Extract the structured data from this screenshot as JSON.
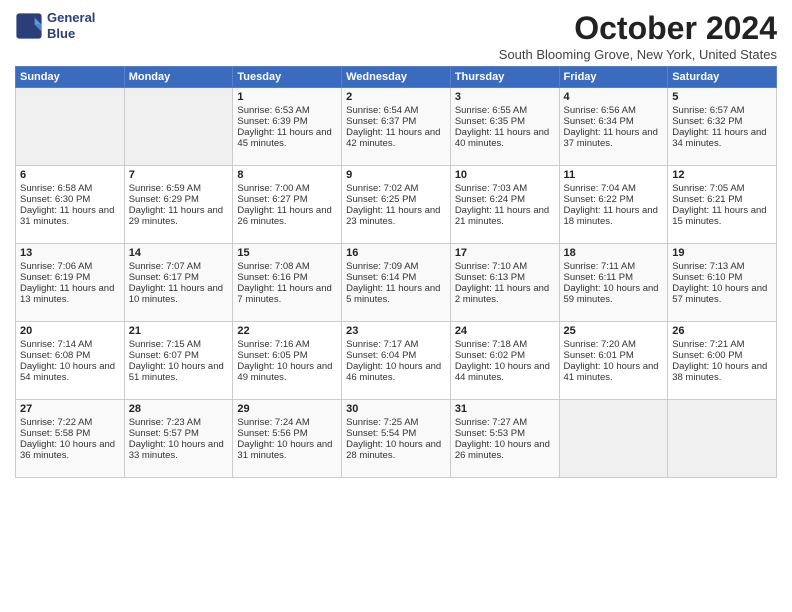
{
  "header": {
    "logo_line1": "General",
    "logo_line2": "Blue",
    "title": "October 2024",
    "location": "South Blooming Grove, New York, United States"
  },
  "days_of_week": [
    "Sunday",
    "Monday",
    "Tuesday",
    "Wednesday",
    "Thursday",
    "Friday",
    "Saturday"
  ],
  "weeks": [
    [
      {
        "day": "",
        "empty": true
      },
      {
        "day": "",
        "empty": true
      },
      {
        "day": "1",
        "sunrise": "6:53 AM",
        "sunset": "6:39 PM",
        "daylight": "11 hours and 45 minutes."
      },
      {
        "day": "2",
        "sunrise": "6:54 AM",
        "sunset": "6:37 PM",
        "daylight": "11 hours and 42 minutes."
      },
      {
        "day": "3",
        "sunrise": "6:55 AM",
        "sunset": "6:35 PM",
        "daylight": "11 hours and 40 minutes."
      },
      {
        "day": "4",
        "sunrise": "6:56 AM",
        "sunset": "6:34 PM",
        "daylight": "11 hours and 37 minutes."
      },
      {
        "day": "5",
        "sunrise": "6:57 AM",
        "sunset": "6:32 PM",
        "daylight": "11 hours and 34 minutes."
      }
    ],
    [
      {
        "day": "6",
        "sunrise": "6:58 AM",
        "sunset": "6:30 PM",
        "daylight": "11 hours and 31 minutes."
      },
      {
        "day": "7",
        "sunrise": "6:59 AM",
        "sunset": "6:29 PM",
        "daylight": "11 hours and 29 minutes."
      },
      {
        "day": "8",
        "sunrise": "7:00 AM",
        "sunset": "6:27 PM",
        "daylight": "11 hours and 26 minutes."
      },
      {
        "day": "9",
        "sunrise": "7:02 AM",
        "sunset": "6:25 PM",
        "daylight": "11 hours and 23 minutes."
      },
      {
        "day": "10",
        "sunrise": "7:03 AM",
        "sunset": "6:24 PM",
        "daylight": "11 hours and 21 minutes."
      },
      {
        "day": "11",
        "sunrise": "7:04 AM",
        "sunset": "6:22 PM",
        "daylight": "11 hours and 18 minutes."
      },
      {
        "day": "12",
        "sunrise": "7:05 AM",
        "sunset": "6:21 PM",
        "daylight": "11 hours and 15 minutes."
      }
    ],
    [
      {
        "day": "13",
        "sunrise": "7:06 AM",
        "sunset": "6:19 PM",
        "daylight": "11 hours and 13 minutes."
      },
      {
        "day": "14",
        "sunrise": "7:07 AM",
        "sunset": "6:17 PM",
        "daylight": "11 hours and 10 minutes."
      },
      {
        "day": "15",
        "sunrise": "7:08 AM",
        "sunset": "6:16 PM",
        "daylight": "11 hours and 7 minutes."
      },
      {
        "day": "16",
        "sunrise": "7:09 AM",
        "sunset": "6:14 PM",
        "daylight": "11 hours and 5 minutes."
      },
      {
        "day": "17",
        "sunrise": "7:10 AM",
        "sunset": "6:13 PM",
        "daylight": "11 hours and 2 minutes."
      },
      {
        "day": "18",
        "sunrise": "7:11 AM",
        "sunset": "6:11 PM",
        "daylight": "10 hours and 59 minutes."
      },
      {
        "day": "19",
        "sunrise": "7:13 AM",
        "sunset": "6:10 PM",
        "daylight": "10 hours and 57 minutes."
      }
    ],
    [
      {
        "day": "20",
        "sunrise": "7:14 AM",
        "sunset": "6:08 PM",
        "daylight": "10 hours and 54 minutes."
      },
      {
        "day": "21",
        "sunrise": "7:15 AM",
        "sunset": "6:07 PM",
        "daylight": "10 hours and 51 minutes."
      },
      {
        "day": "22",
        "sunrise": "7:16 AM",
        "sunset": "6:05 PM",
        "daylight": "10 hours and 49 minutes."
      },
      {
        "day": "23",
        "sunrise": "7:17 AM",
        "sunset": "6:04 PM",
        "daylight": "10 hours and 46 minutes."
      },
      {
        "day": "24",
        "sunrise": "7:18 AM",
        "sunset": "6:02 PM",
        "daylight": "10 hours and 44 minutes."
      },
      {
        "day": "25",
        "sunrise": "7:20 AM",
        "sunset": "6:01 PM",
        "daylight": "10 hours and 41 minutes."
      },
      {
        "day": "26",
        "sunrise": "7:21 AM",
        "sunset": "6:00 PM",
        "daylight": "10 hours and 38 minutes."
      }
    ],
    [
      {
        "day": "27",
        "sunrise": "7:22 AM",
        "sunset": "5:58 PM",
        "daylight": "10 hours and 36 minutes."
      },
      {
        "day": "28",
        "sunrise": "7:23 AM",
        "sunset": "5:57 PM",
        "daylight": "10 hours and 33 minutes."
      },
      {
        "day": "29",
        "sunrise": "7:24 AM",
        "sunset": "5:56 PM",
        "daylight": "10 hours and 31 minutes."
      },
      {
        "day": "30",
        "sunrise": "7:25 AM",
        "sunset": "5:54 PM",
        "daylight": "10 hours and 28 minutes."
      },
      {
        "day": "31",
        "sunrise": "7:27 AM",
        "sunset": "5:53 PM",
        "daylight": "10 hours and 26 minutes."
      },
      {
        "day": "",
        "empty": true
      },
      {
        "day": "",
        "empty": true
      }
    ]
  ],
  "labels": {
    "sunrise": "Sunrise:",
    "sunset": "Sunset:",
    "daylight": "Daylight:"
  }
}
